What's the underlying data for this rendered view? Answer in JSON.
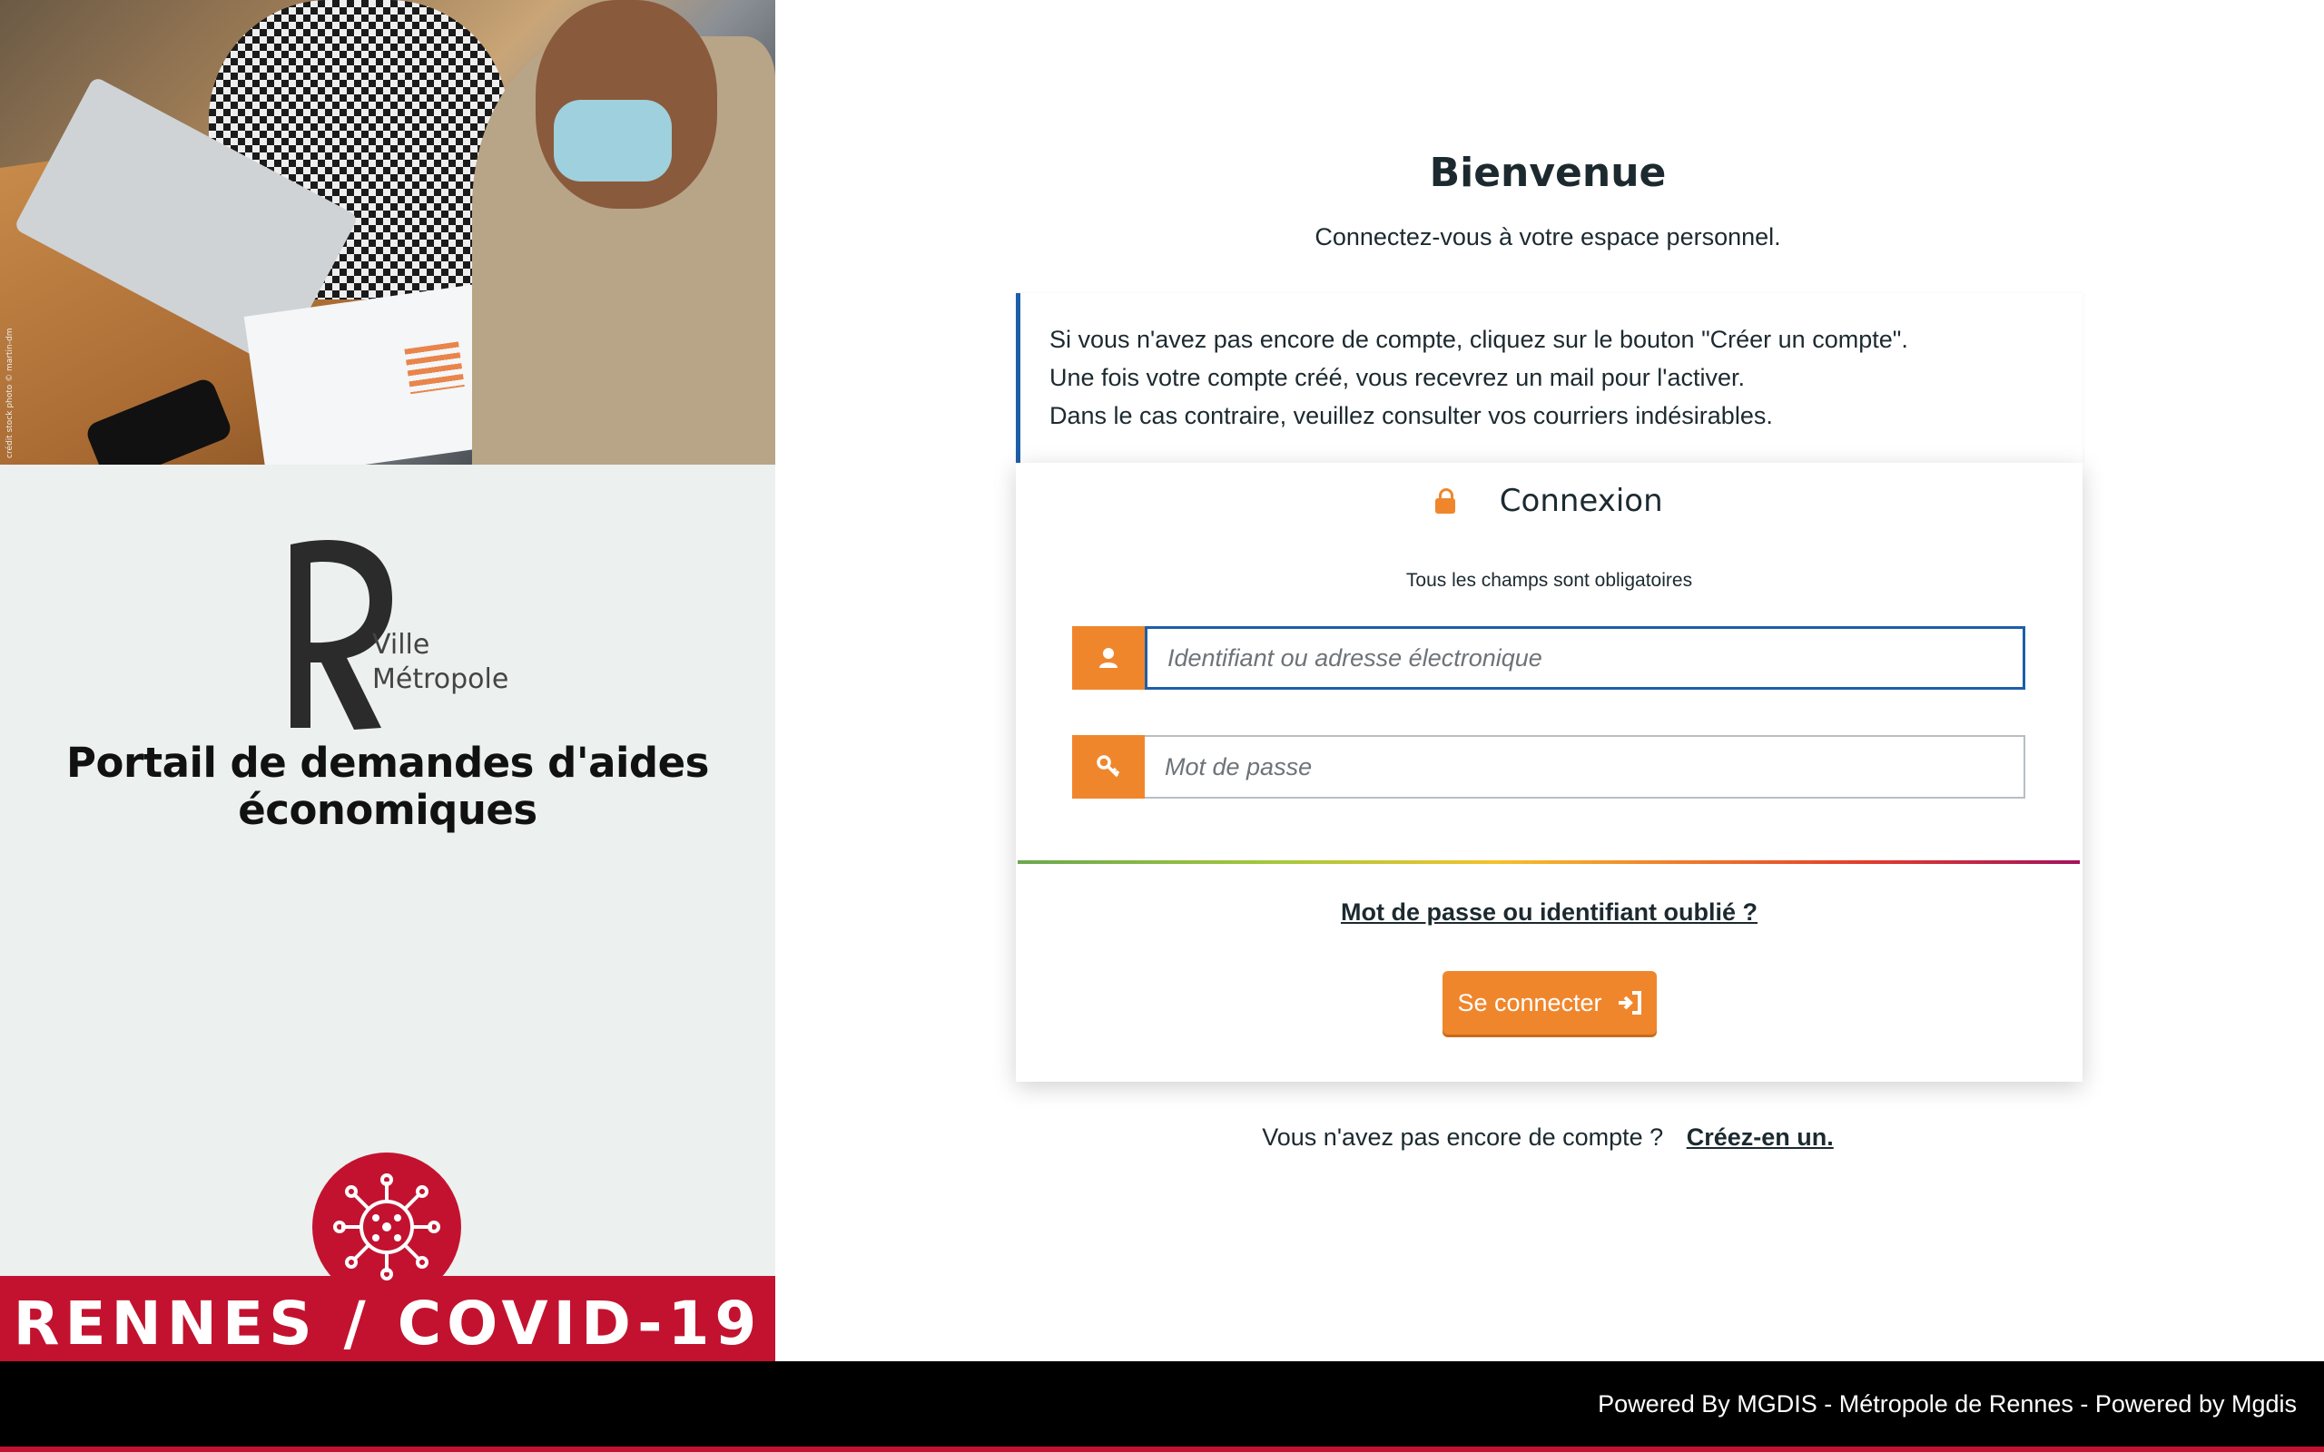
{
  "left": {
    "photo_credit": "crédit stock photo © martin-dm",
    "logo_text_line1": "Ville",
    "logo_text_line2": "Métropole",
    "portal_title_line1": "Portail de demandes d'aides",
    "portal_title_line2": "économiques",
    "covid_banner": "RENNES / COVID-19"
  },
  "main": {
    "welcome_title": "Bienvenue",
    "welcome_subtitle": "Connectez-vous à votre espace personnel.",
    "info_lines": [
      "Si vous n'avez pas encore de compte, cliquez sur le bouton \"Créer un compte\".",
      "Une fois votre compte créé, vous recevrez un mail pour l'activer.",
      "Dans le cas contraire, veuillez consulter vos courriers indésirables."
    ]
  },
  "login": {
    "title": "Connexion",
    "required_note": "Tous les champs sont obligatoires",
    "username_placeholder": "Identifiant ou adresse électronique",
    "username_value": "",
    "password_placeholder": "Mot de passe",
    "password_value": "",
    "forgot_link": "Mot de passe ou identifiant oublié ?",
    "submit_label": "Se connecter"
  },
  "signup": {
    "question": "Vous n'avez pas encore de compte ?",
    "link": "Créez-en un."
  },
  "footer": {
    "text": "Powered By MGDIS - Métropole de Rennes - Powered by Mgdis"
  },
  "colors": {
    "accent_orange": "#f0862c",
    "focus_blue": "#1d5fa8",
    "covid_red": "#c3122f"
  },
  "icons": [
    "lock-icon",
    "user-icon",
    "key-icon",
    "sign-in-icon",
    "virus-icon"
  ]
}
